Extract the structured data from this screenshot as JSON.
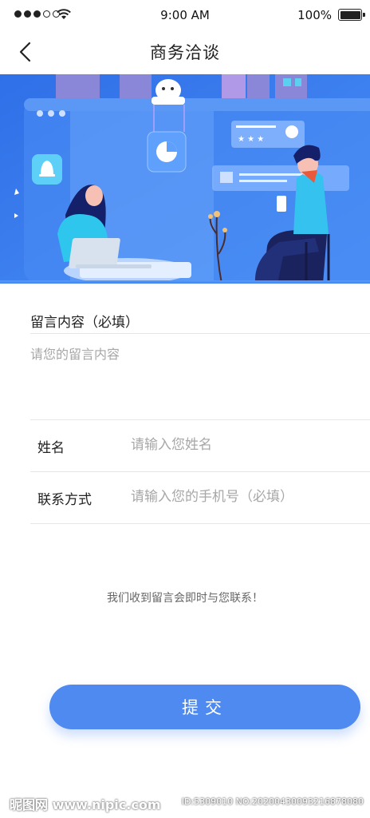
{
  "status_bar": {
    "time": "9:00 AM",
    "battery": "100%"
  },
  "nav": {
    "title": "商务洽谈",
    "back_icon": "chevron-left-icon"
  },
  "hero": {
    "description_icons": [
      "bell-icon",
      "pie-chart-icon",
      "chat-card-icon",
      "avatar-icon"
    ]
  },
  "form": {
    "content_label": "留言内容（必填）",
    "content_placeholder": "请您的留言内容",
    "name_label": "姓名",
    "name_placeholder": "请输入您姓名",
    "phone_label": "联系方式",
    "phone_placeholder": "请输入您的手机号（必填）"
  },
  "notice": "我们收到留言会即时与您联系！",
  "submit_label": "提交",
  "watermark": {
    "left": "昵图网 www.nipic.com",
    "right": "ID:5309010 NO:20200430093216878080"
  },
  "colors": {
    "primary": "#4f8af0",
    "hero_bg": "#3b7ff0"
  }
}
